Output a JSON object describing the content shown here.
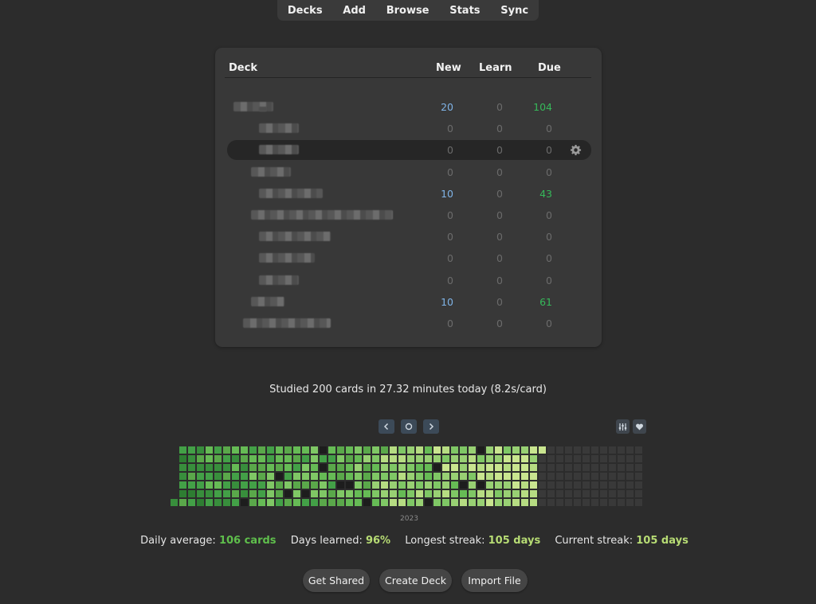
{
  "nav": {
    "items": [
      "Decks",
      "Add",
      "Browse",
      "Stats",
      "Sync"
    ]
  },
  "deck_table": {
    "columns": {
      "deck": "Deck",
      "new": "New",
      "learn": "Learn",
      "due": "Due"
    },
    "rows": [
      {
        "new": "20",
        "learn": "0",
        "due": "104"
      },
      {
        "new": "0",
        "learn": "0",
        "due": "0"
      },
      {
        "new": "0",
        "learn": "0",
        "due": "0"
      },
      {
        "new": "0",
        "learn": "0",
        "due": "0"
      },
      {
        "new": "10",
        "learn": "0",
        "due": "43"
      },
      {
        "new": "0",
        "learn": "0",
        "due": "0"
      },
      {
        "new": "0",
        "learn": "0",
        "due": "0"
      },
      {
        "new": "0",
        "learn": "0",
        "due": "0"
      },
      {
        "new": "0",
        "learn": "0",
        "due": "0"
      },
      {
        "new": "10",
        "learn": "0",
        "due": "61"
      },
      {
        "new": "0",
        "learn": "0",
        "due": "0"
      }
    ]
  },
  "summary": "Studied 200 cards in 27.32 minutes today (8.2s/card)",
  "heatmap": {
    "year_label": "2023",
    "icons": [
      "chevron-left-icon",
      "circle-icon",
      "chevron-right-icon",
      "sliders-icon",
      "heart-icon"
    ]
  },
  "stats": {
    "daily_average_label": "Daily average:",
    "daily_average_value": "106 cards",
    "days_learned_label": "Days learned:",
    "days_learned_value": "96%",
    "longest_streak_label": "Longest streak:",
    "longest_streak_value": "105 days",
    "current_streak_label": "Current streak:",
    "current_streak_value": "105 days"
  },
  "buttons": {
    "get_shared": "Get Shared",
    "create_deck": "Create Deck",
    "import_file": "Import File"
  },
  "colors": {
    "background": "#2c2c2c",
    "panel": "#383838",
    "new_count": "#7fb3e6",
    "due_count": "#36b95a",
    "stat_green": "#5fbf4c",
    "stat_lime": "#b7dc74"
  }
}
